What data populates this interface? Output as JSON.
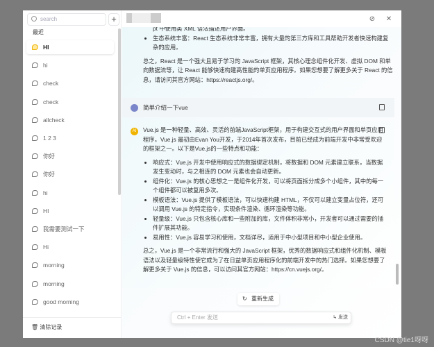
{
  "sidebar": {
    "search_placeholder": "search",
    "add": "+",
    "section": "最近",
    "items": [
      "HI",
      "hi",
      "check",
      "check",
      "allcheck",
      "1 2 3",
      "你好",
      "你好",
      "hi",
      "HI",
      "我需要测试一下",
      "Hi",
      "morning",
      "morning",
      "good morning"
    ],
    "clear": "清除记录"
  },
  "header": {
    "pin_icon": "⊘",
    "close_icon": "✕"
  },
  "prev_answer": {
    "line0": "pt 中使用类 XML 语法描述用户界面。",
    "bullet": "生态系统丰富：React 生态系统非常丰富，拥有大量的第三方库和工具帮助开发者快速构建复杂的应用。",
    "summary": "总之，React 是一个强大且易于学习的 JavaScript 框架，其核心理念组件化开发、虚拟 DOM 和单向数据流等，让 React 能够快速构建高性能的单页应用程序。如果您想要了解更多关于 React 的信息，请访问其官方网站：https://reactjs.org/。"
  },
  "question": "简单介绍一下vue",
  "answer": {
    "intro": "Vue.js 是一种轻量、高效、灵活的前端JavaScript框架，用于构建交互式的用户界面和单页应用程序。Vue.js 最初由Evan You开发，于2014年首次发布，目前已经成为前端开发中非常受欢迎的框架之一。以下是Vue.js的一些特点和功能：",
    "bullets": [
      "响应式：Vue.js 开发中使用响应式的数据绑定机制，将数据和 DOM 元素建立联系，当数据发生变动时，与之相连的 DOM 元素也会自动更新。",
      "组件化：Vue.js 的核心思想之一是组件化开发，可以将页面拆分成多个小组件，其中的每一个组件都可以被复用多次。",
      "模板语法：Vue.js 提供了模板语法，可以快速构建 HTML，不仅可以建立变量占位符，还可以调用 Vue.js 的特定指令，实现条件渲染、循环渲染等功能。",
      "轻量级：Vue.js 只包含核心库和一些附加的库，文件体积非常小，开发者可以通过需要的插件扩展其功能。",
      "易用性：Vue.js 容易学习和使用，文档详尽，适用于中小型项目和中小型企业使用。"
    ],
    "summary": "总之，Vue.js 是一个非常流行和强大的 JavaScript 框架，优秀的数据响应式和组件化机制、模板语法以及轻量级特性使它成为了在日益单页应用程序化的前端开发中的热门选择。如果您想要了解更多关于 Vue.js 的信息，可以访问其官方网站：https://cn.vuejs.org/。"
  },
  "regenerate": "重新生成",
  "input": {
    "placeholder": "Ctrl + Enter 发送",
    "send": "↳ 发送"
  },
  "watermark": "CSDN @tie1呀呀",
  "colors": {
    "accent": "#f0b400",
    "background": "#7b7b7b"
  }
}
